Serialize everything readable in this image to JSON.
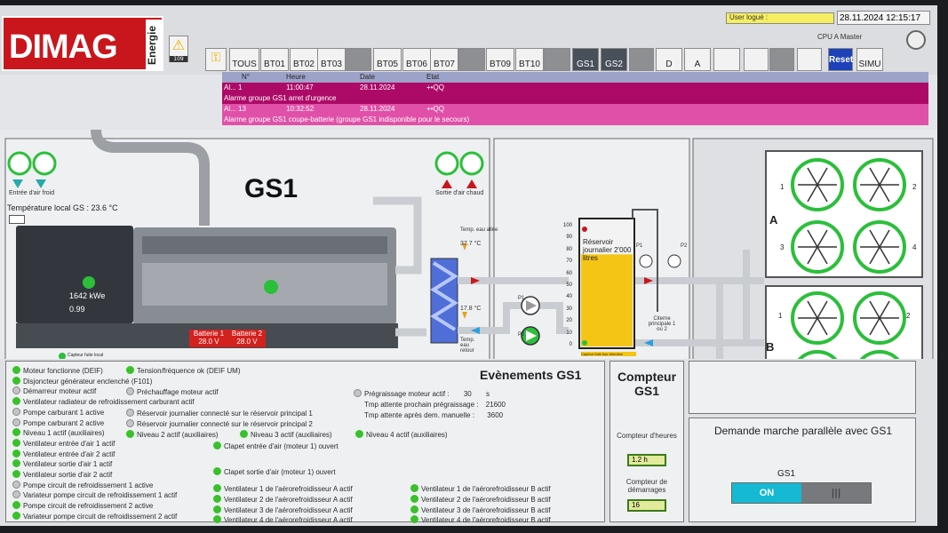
{
  "header": {
    "logo_text": "DIMAG",
    "logo_sub": "Energie",
    "alarm_count": "109",
    "user_label": "User logué :",
    "date": "28.11.2024",
    "time": "12:15:17",
    "cpu": "CPU A Master"
  },
  "toolbar": {
    "buttons": [
      "TOUS",
      "BT01",
      "BT02",
      "BT03",
      "BT05",
      "BT06",
      "BT07",
      "BT09",
      "BT10",
      "GS1",
      "GS2",
      "D",
      "A",
      "Reset",
      "SIMU"
    ]
  },
  "alarms": {
    "columns": [
      "N°",
      "Heure",
      "Date",
      "Etat"
    ],
    "rows": [
      {
        "id": "Al... 1",
        "time": "11:00:47",
        "date": "28.11.2024",
        "state": "+•QQ",
        "text": "Alarme groupe GS1 arret d'urgence"
      },
      {
        "id": "Al... 13",
        "time": "10:32:52",
        "date": "28.11.2024",
        "state": "+•QQ",
        "text": "Alarme groupe GS1 coupe-batterie (groupe GS1 indisponible pour le secours)"
      }
    ]
  },
  "synoptic": {
    "title": "GS1",
    "air_in": "Entrée d'air froid",
    "air_out": "Sortie d'air chaud",
    "temp_local": "Température local GS :  23.6 °C",
    "power_val": "1642",
    "power_unit": "kWe",
    "pf_val": "0.99",
    "battery1_label": "Batterie 1",
    "battery1_val": "28.0 V",
    "battery2_label": "Batterie 2",
    "battery2_val": "28.0 V",
    "leak_sensor": "Capteur fuite local",
    "temp_out_label": "Temp. eau allée",
    "temp_out": "37.7 °C",
    "temp_ret": "17.8 °C",
    "temp_ret_label": "Temp. eau retour",
    "pump_p1": "P1",
    "pump_p2": "P2",
    "tank_label": "Réservoir journalier 2'000 litres",
    "tank_sensor": "Capteur fuite bac rétention",
    "tank_level": 0.72,
    "scale": [
      "100",
      "90",
      "80",
      "70",
      "60",
      "50",
      "40",
      "30",
      "20",
      "10",
      "0"
    ],
    "main_tank": "Citerne principale 1 ou 2",
    "cooler_a": "A",
    "cooler_b": "B",
    "fan_nums": [
      "1",
      "2",
      "3",
      "4"
    ]
  },
  "status_left": [
    {
      "t": "Moteur fonctionne (DEIF)",
      "on": true
    },
    {
      "t": "Disjoncteur générateur enclenché (F101)",
      "on": true
    },
    {
      "t": "Démarreur moteur actif",
      "on": false
    },
    {
      "t": "Ventilateur radiateur de refroidissement carburant actif",
      "on": true
    },
    {
      "t": "Pompe carburant 1 active",
      "on": false
    },
    {
      "t": "Pompe carburant 2 active",
      "on": false
    },
    {
      "t": "Niveau 1 actif (auxiliaires)",
      "on": true
    },
    {
      "t": "Ventilateur entrée d'air 1 actif",
      "on": true
    },
    {
      "t": "Ventilateur entrée d'air 2 actif",
      "on": true
    },
    {
      "t": "Ventilateur sortie d'air 1 actif",
      "on": true
    },
    {
      "t": "Ventilateur sortie d'air 2 actif",
      "on": true
    },
    {
      "t": "Pompe circuit de refroidissement 1 active",
      "on": false
    },
    {
      "t": "Variateur pompe circuit de refroidissement 1 actif",
      "on": false
    },
    {
      "t": "Pompe circuit de refroidissement 2 active",
      "on": true
    },
    {
      "t": "Variateur pompe circuit de refroidissement 2 actif",
      "on": true
    }
  ],
  "status_mid": [
    {
      "t": "Tension/fréquence ok (DEIF UM)",
      "on": true
    },
    {
      "t": "Préchauffage moteur actif",
      "on": false
    },
    {
      "t": "Réservoir journalier connecté sur le réservoir principal 1",
      "on": false
    },
    {
      "t": "Réservoir journalier connecté sur le réservoir principal 2",
      "on": false
    },
    {
      "t": "Niveau 2 actif (auxiliaires)",
      "on": true
    },
    {
      "t": "Niveau 3 actif (auxiliaires)",
      "on": true
    },
    {
      "t": "Niveau 4 actif (auxiliaires)",
      "on": true
    },
    {
      "t": "Clapet entrée d'air (moteur 1) ouvert",
      "on": true
    },
    {
      "t": "Clapet sortie d'air (moteur 1) ouvert",
      "on": true
    },
    {
      "t": "Ventilateur 1 de l'aérorefroidisseur A actif",
      "on": true
    },
    {
      "t": "Ventilateur 2 de l'aérorefroidisseur A actif",
      "on": true
    },
    {
      "t": "Ventilateur 3 de l'aérorefroidisseur A actif",
      "on": true
    },
    {
      "t": "Ventilateur 4 de l'aérorefroidisseur A actif",
      "on": true
    },
    {
      "t": "Ventilateur 1 de l'aérorefroidisseur B actif",
      "on": true
    },
    {
      "t": "Ventilateur 2 de l'aérorefroidisseur B actif",
      "on": true
    },
    {
      "t": "Ventilateur 3 de l'aérorefroidisseur B actif",
      "on": true
    },
    {
      "t": "Ventilateur 4 de l'aérorefroidisseur B actif",
      "on": true
    }
  ],
  "timing": {
    "title": "Evènements GS1",
    "pre_label": "Prégraissage moteur actif :",
    "pre_val": "30",
    "pre_unit": "s",
    "next_label": "Tmp attente prochain prégraissage :",
    "next_val": "21600",
    "after_label": "Tmp attente après dem. manuelle :",
    "after_val": "3600"
  },
  "counter": {
    "title": "Compteur GS1",
    "hours_label": "Compteur d'heures",
    "hours_val": "1.2 h",
    "starts_label": "Compteur de démarrages",
    "starts_val": "16"
  },
  "parallel": {
    "title": "Demande marche parallèle avec GS1",
    "gs_label": "GS1",
    "toggle_on": "ON",
    "toggle_off": "|||"
  }
}
